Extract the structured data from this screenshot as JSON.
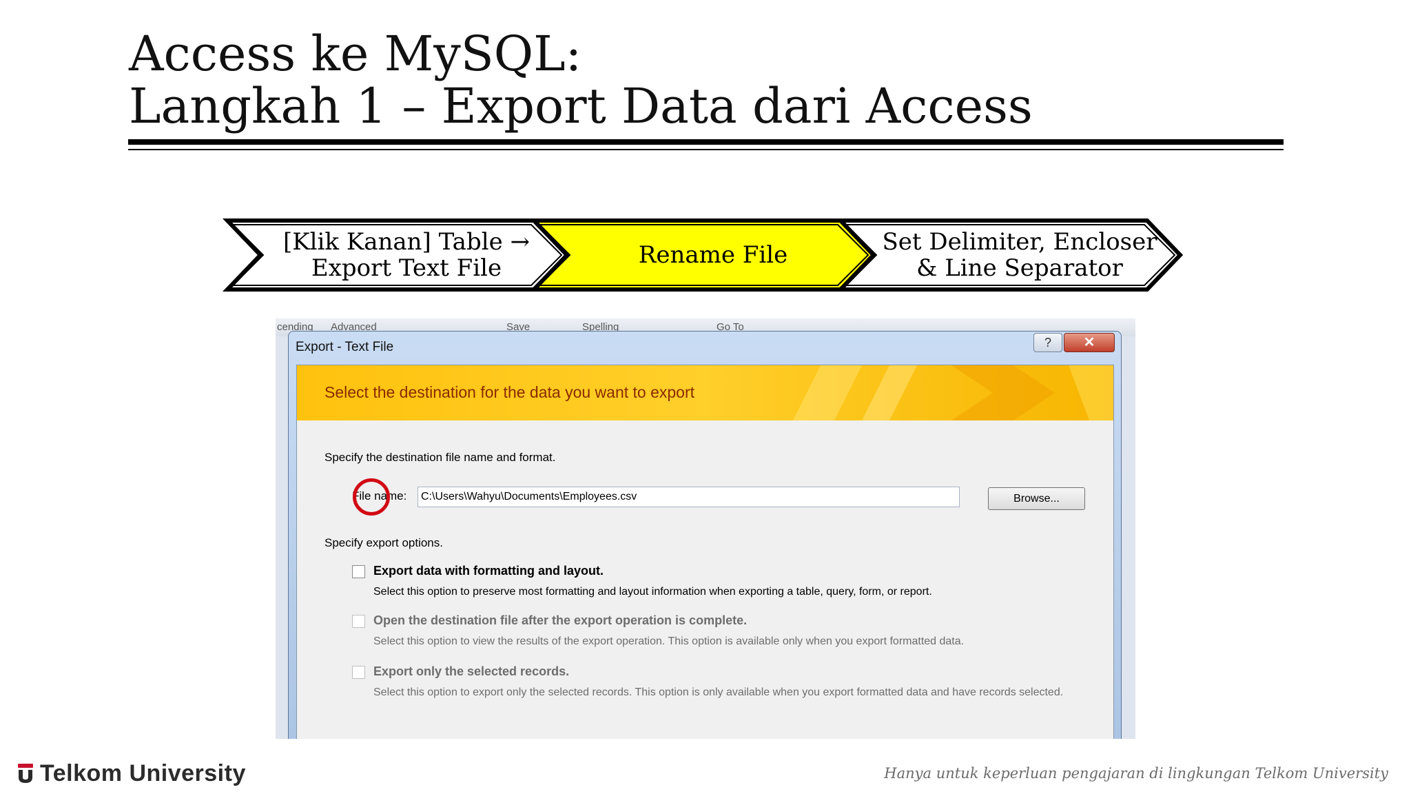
{
  "slide": {
    "title_line1": "Access ke MySQL:",
    "title_line2": "Langkah 1 – Export Data dari Access"
  },
  "process": {
    "steps": [
      {
        "line1": "[Klik Kanan] Table →",
        "line2": "Export Text File",
        "highlighted": false
      },
      {
        "line1": "Rename File",
        "line2": "",
        "highlighted": true
      },
      {
        "line1": "Set Delimiter, Encloser",
        "line2": "& Line Separator",
        "highlighted": false
      }
    ],
    "highlight_color": "#ffff00"
  },
  "app_ribbon": {
    "items": [
      "cending",
      "Advanced",
      "Save",
      "Spelling",
      "Go To"
    ]
  },
  "dialog": {
    "title": "Export - Text File",
    "help_label": "?",
    "close_label": "✕",
    "banner": "Select the destination for the data you want to export",
    "specify_file": "Specify the destination file name and format.",
    "file_name_label": "File name:",
    "file_name_value": "C:\\Users\\Wahyu\\Documents\\Employees.csv",
    "browse_label": "Browse...",
    "specify_options": "Specify export options.",
    "options": [
      {
        "label": "Export data with formatting and layout.",
        "description": "Select this option to preserve most formatting and layout information when exporting a table, query, form, or report.",
        "enabled": true,
        "checked": false
      },
      {
        "label": "Open the destination file after the export operation is complete.",
        "description": "Select this option to view the results of the export operation. This option is available only when you export formatted data.",
        "enabled": false,
        "checked": false
      },
      {
        "label": "Export only the selected records.",
        "description": "Select this option to export only the selected records. This option is only available when you export formatted data and have records selected.",
        "enabled": false,
        "checked": false
      }
    ],
    "annotation_color": "#d10a14"
  },
  "footer": {
    "logo_text": "Telkom University",
    "note": "Hanya untuk keperluan pengajaran di lingkungan Telkom University"
  }
}
